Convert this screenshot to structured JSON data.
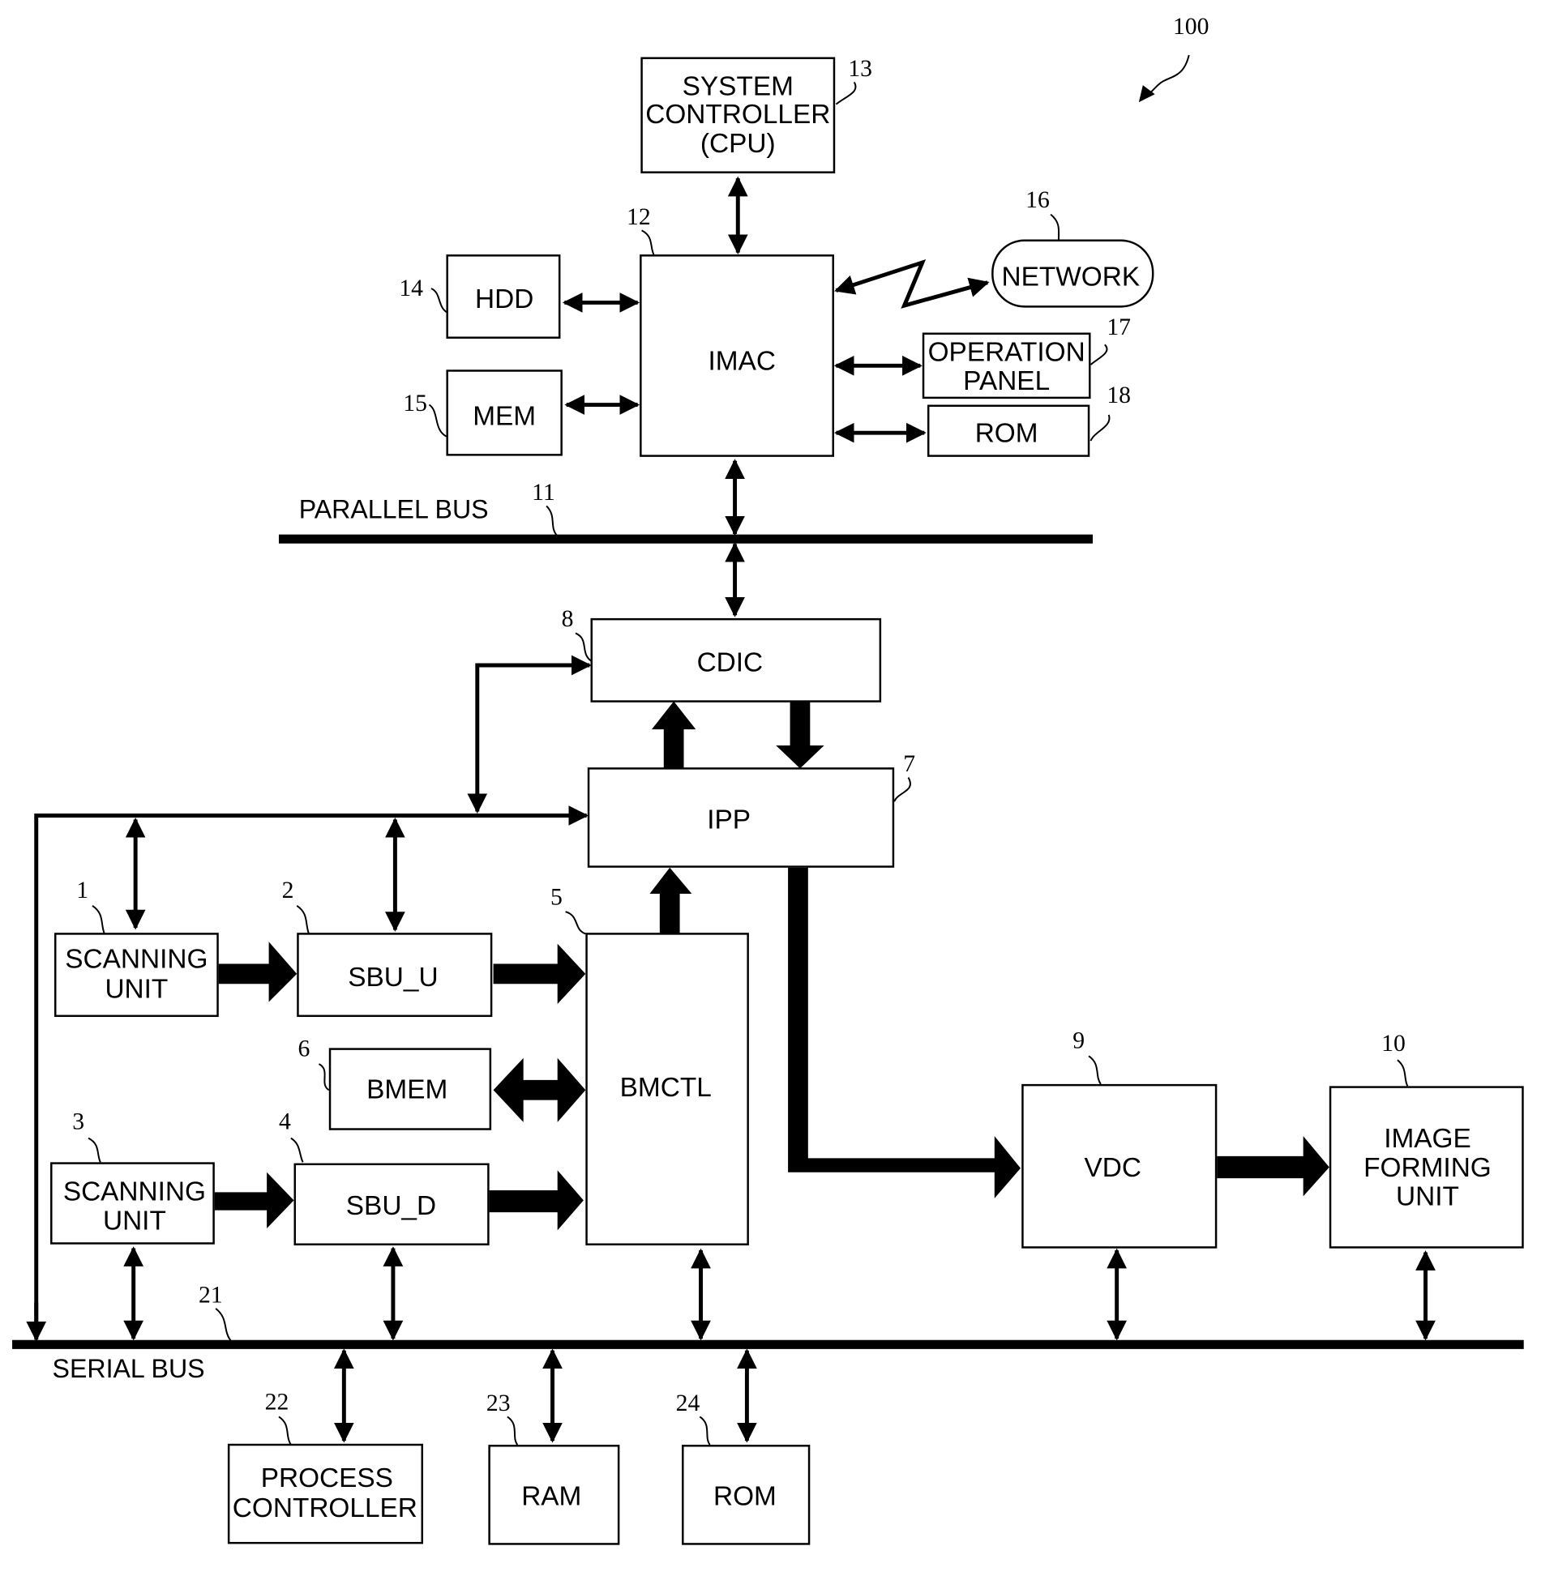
{
  "figure": {
    "ref": "100",
    "blocks": {
      "scanning_unit_1": {
        "ref": "1",
        "lines": [
          "SCANNING",
          "UNIT"
        ]
      },
      "sbu_u": {
        "ref": "2",
        "lines": [
          "SBU_U"
        ]
      },
      "scanning_unit_3": {
        "ref": "3",
        "lines": [
          "SCANNING",
          "UNIT"
        ]
      },
      "sbu_d": {
        "ref": "4",
        "lines": [
          "SBU_D"
        ]
      },
      "bmctl": {
        "ref": "5",
        "lines": [
          "BMCTL"
        ]
      },
      "bmem": {
        "ref": "6",
        "lines": [
          "BMEM"
        ]
      },
      "ipp": {
        "ref": "7",
        "lines": [
          "IPP"
        ]
      },
      "cdic": {
        "ref": "8",
        "lines": [
          "CDIC"
        ]
      },
      "vdc": {
        "ref": "9",
        "lines": [
          "VDC"
        ]
      },
      "image_forming_unit": {
        "ref": "10",
        "lines": [
          "IMAGE",
          "FORMING",
          "UNIT"
        ]
      },
      "imac": {
        "ref": "12",
        "lines": [
          "IMAC"
        ]
      },
      "system_controller": {
        "ref": "13",
        "lines": [
          "SYSTEM",
          "CONTROLLER",
          "(CPU)"
        ]
      },
      "hdd": {
        "ref": "14",
        "lines": [
          "HDD"
        ]
      },
      "mem": {
        "ref": "15",
        "lines": [
          "MEM"
        ]
      },
      "network": {
        "ref": "16",
        "lines": [
          "NETWORK"
        ]
      },
      "operation_panel": {
        "ref": "17",
        "lines": [
          "OPERATION",
          "PANEL"
        ]
      },
      "rom_18": {
        "ref": "18",
        "lines": [
          "ROM"
        ]
      },
      "process_controller": {
        "ref": "22",
        "lines": [
          "PROCESS",
          "CONTROLLER"
        ]
      },
      "ram": {
        "ref": "23",
        "lines": [
          "RAM"
        ]
      },
      "rom_24": {
        "ref": "24",
        "lines": [
          "ROM"
        ]
      }
    },
    "buses": {
      "parallel": {
        "ref": "11",
        "label": "PARALLEL BUS"
      },
      "serial": {
        "ref": "21",
        "label": "SERIAL BUS"
      }
    }
  }
}
